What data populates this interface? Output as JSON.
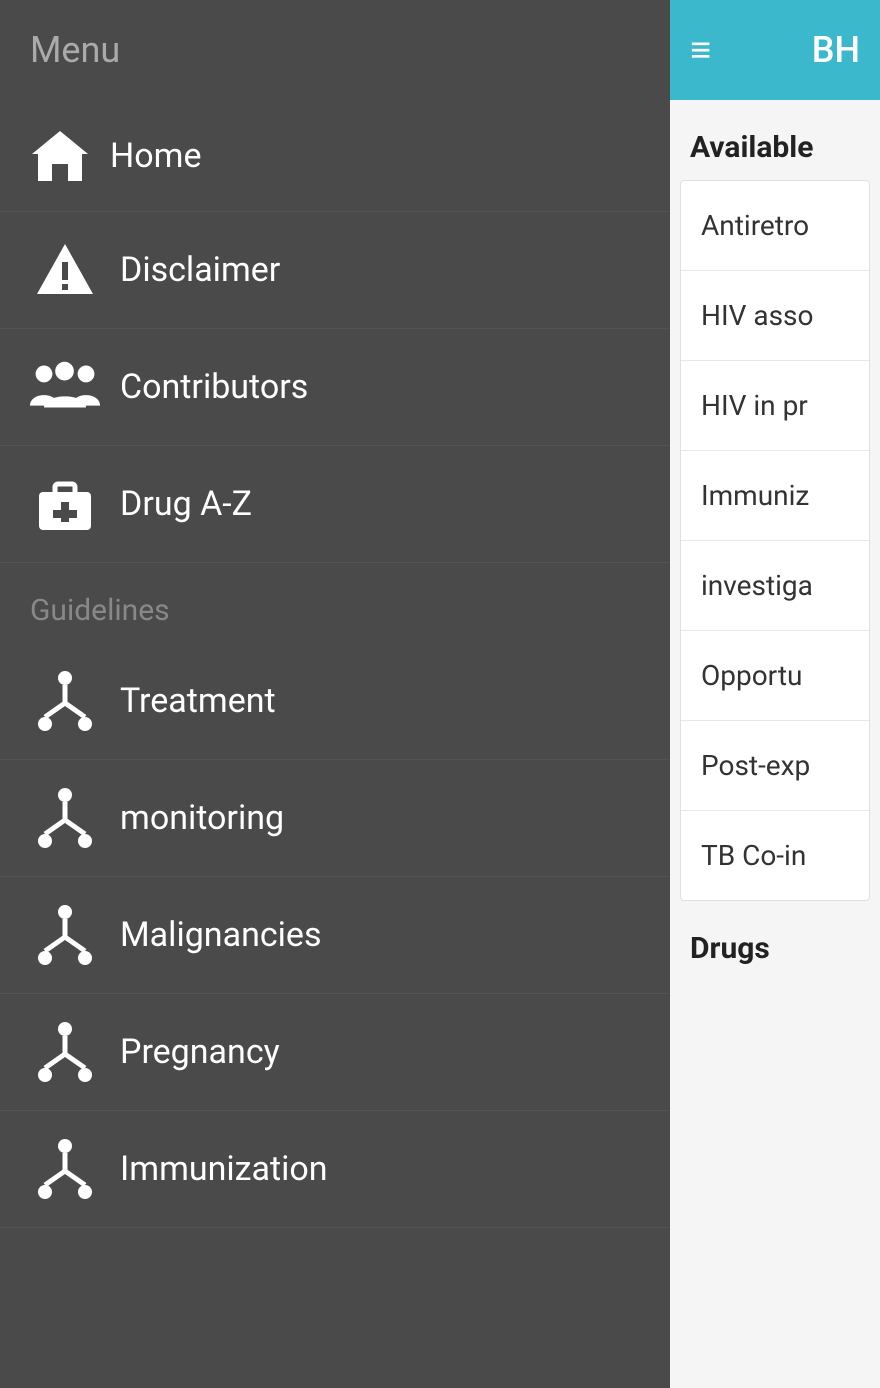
{
  "header": {
    "menu_label": "Menu",
    "hamburger": "≡",
    "app_title": "BH"
  },
  "sidebar": {
    "items": [
      {
        "id": "home",
        "label": "Home",
        "icon": "home"
      },
      {
        "id": "disclaimer",
        "label": "Disclaimer",
        "icon": "warning"
      },
      {
        "id": "contributors",
        "label": "Contributors",
        "icon": "contributors"
      },
      {
        "id": "drug-az",
        "label": "Drug A-Z",
        "icon": "drug"
      }
    ],
    "guidelines_label": "Guidelines",
    "guideline_items": [
      {
        "id": "treatment",
        "label": "Treatment",
        "icon": "fork"
      },
      {
        "id": "monitoring",
        "label": "monitoring",
        "icon": "fork"
      },
      {
        "id": "malignancies",
        "label": "Malignancies",
        "icon": "fork"
      },
      {
        "id": "pregnancy",
        "label": "Pregnancy",
        "icon": "fork"
      },
      {
        "id": "immunization",
        "label": "Immunization",
        "icon": "fork"
      }
    ]
  },
  "right_panel": {
    "available_title": "Available",
    "list_items": [
      "Antiretro",
      "HIV asso",
      "HIV in pr",
      "Immuniz",
      "investiga",
      "Opportu",
      "Post-exp",
      "TB Co-in"
    ],
    "drugs_title": "Drugs"
  },
  "colors": {
    "header_bg": "#4a4a4a",
    "teal": "#3cb8cc",
    "sidebar_bg": "#4a4a4a",
    "white": "#ffffff",
    "section_label": "#888888"
  }
}
